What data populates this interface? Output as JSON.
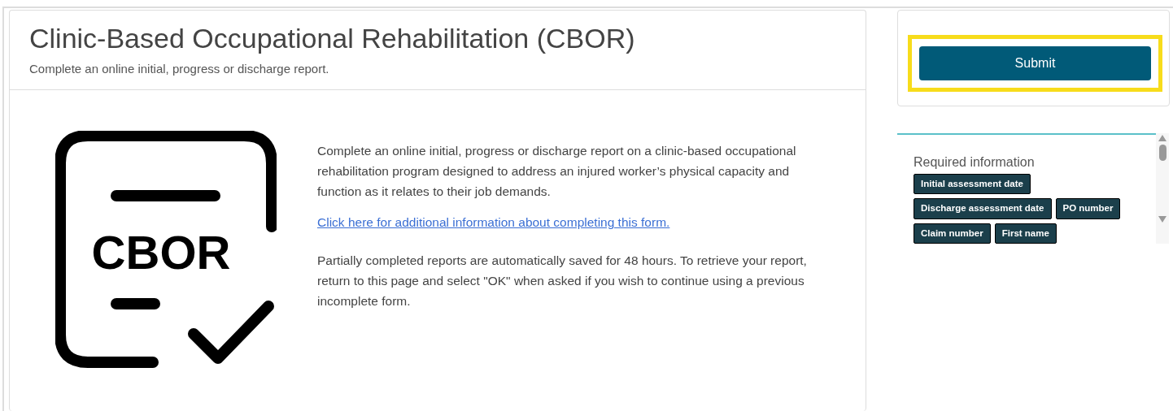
{
  "header": {
    "title": "Clinic-Based Occupational Rehabilitation (CBOR)",
    "subtitle": "Complete an online initial, progress or discharge report."
  },
  "logo": {
    "text": "CBOR"
  },
  "description": "Complete an online initial, progress or discharge report on a clinic-based occupational rehabilitation program designed to address an injured worker’s physical capacity and function as it relates to their job demands.",
  "info_link": "Click here for additional information about completing this form.",
  "save_note": "Partially completed reports are automatically saved for 48 hours.  To retrieve your report, return to this page and select \"OK\" when asked if you wish to continue using a previous incomplete form.",
  "submit": {
    "label": "Submit",
    "highlighted": true
  },
  "required": {
    "title": "Required information",
    "tags": [
      "Initial assessment date",
      "Discharge assessment date",
      "PO number",
      "Claim number",
      "First name"
    ]
  }
}
